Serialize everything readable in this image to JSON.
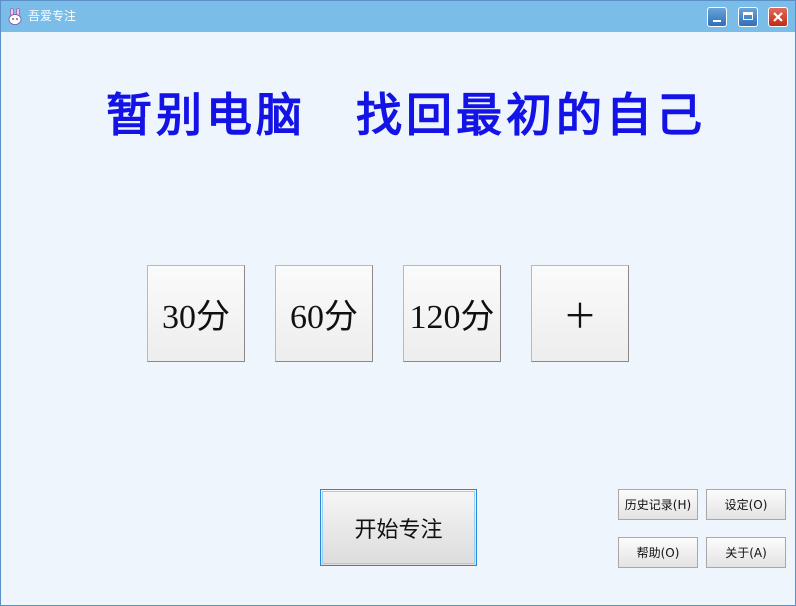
{
  "window": {
    "title": "吾爱专注"
  },
  "headline": "暂别电脑　找回最初的自己",
  "presets": [
    {
      "label": "30分"
    },
    {
      "label": "60分"
    },
    {
      "label": "120分"
    },
    {
      "label": "＋"
    }
  ],
  "actions": {
    "start": "开始专注",
    "history": "历史记录(H)",
    "settings": "设定(O)",
    "help": "帮助(O)",
    "about": "关于(A)"
  },
  "colors": {
    "title_bar": "#7bbde9",
    "headline": "#1313e6",
    "background": "#eef5fc"
  }
}
